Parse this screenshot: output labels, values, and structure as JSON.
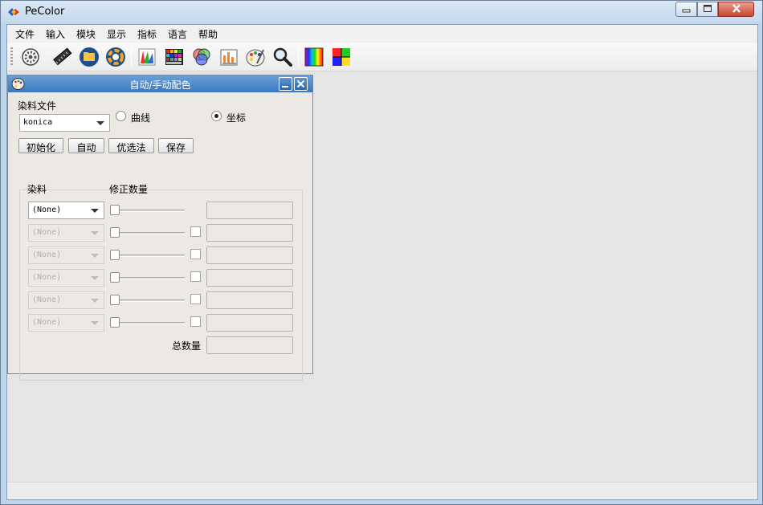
{
  "app": {
    "title": "PeColor"
  },
  "menu": [
    "文件",
    "输入",
    "模块",
    "显示",
    "指标",
    "语言",
    "帮助"
  ],
  "toolbar_icons": [
    "settings-cog-icon",
    "ruler-icon",
    "open-folder-icon",
    "color-wheel-ring-icon",
    "color-fan-icon",
    "color-grid-icon",
    "rgb-circles-icon",
    "chart-document-icon",
    "palette-icon",
    "magnifier-icon",
    "spectrum-icon",
    "color-square-icon"
  ],
  "dialog": {
    "title": "自动/手动配色",
    "dye_file_label": "染料文件",
    "dye_file_value": "konica",
    "radio_curve": "曲线",
    "radio_coord": "坐标",
    "selected_radio": "坐标",
    "buttons": {
      "init": "初始化",
      "auto": "自动",
      "optimize": "优选法",
      "save": "保存"
    },
    "col_dye": "染料",
    "col_amount": "修正数量",
    "rows": [
      {
        "dye": "(None)",
        "enabled": true
      },
      {
        "dye": "(None)",
        "enabled": false
      },
      {
        "dye": "(None)",
        "enabled": false
      },
      {
        "dye": "(None)",
        "enabled": false
      },
      {
        "dye": "(None)",
        "enabled": false
      },
      {
        "dye": "(None)",
        "enabled": false
      }
    ],
    "total_label": "总数量"
  }
}
